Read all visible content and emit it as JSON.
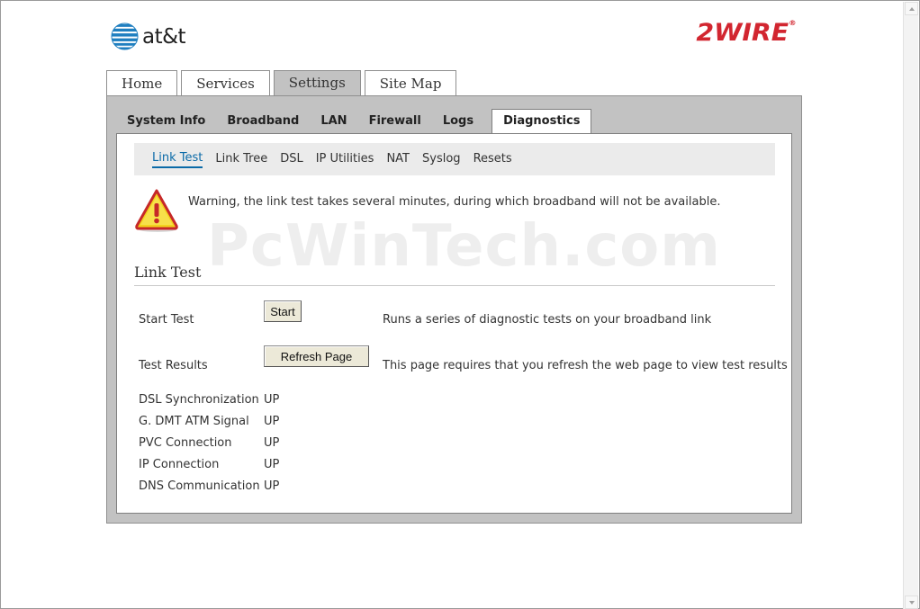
{
  "brand": {
    "att_label": "at&t",
    "wire_label": "2WIRE",
    "wire_mark": "®",
    "colors": {
      "wire_red": "#d22630",
      "att_blue": "#1f7fc0",
      "link_blue": "#0a6aa8",
      "panel_gray": "#c2c2c2"
    }
  },
  "main_tabs": [
    {
      "label": "Home"
    },
    {
      "label": "Services"
    },
    {
      "label": "Settings",
      "active": true
    },
    {
      "label": "Site Map"
    }
  ],
  "sub_tabs": [
    {
      "label": "System Info"
    },
    {
      "label": "Broadband"
    },
    {
      "label": "LAN"
    },
    {
      "label": "Firewall"
    },
    {
      "label": "Logs"
    },
    {
      "label": "Diagnostics",
      "active": true
    }
  ],
  "sub_nav": [
    {
      "label": "Link Test",
      "active": true
    },
    {
      "label": "Link Tree"
    },
    {
      "label": "DSL"
    },
    {
      "label": "IP Utilities"
    },
    {
      "label": "NAT"
    },
    {
      "label": "Syslog"
    },
    {
      "label": "Resets"
    }
  ],
  "warning": {
    "icon": "warning-icon",
    "text": "Warning, the link test takes several minutes, during which broadband will not be available."
  },
  "watermark": "PcWinTech.com",
  "link_test": {
    "title": "Link Test",
    "start": {
      "label": "Start Test",
      "button": "Start",
      "description": "Runs a series of diagnostic tests on your broadband link"
    },
    "results": {
      "label": "Test Results",
      "button": "Refresh Page",
      "description": "This page requires that you refresh the web page to view test results"
    },
    "statuses": [
      {
        "name": "DSL Synchronization",
        "value": "UP"
      },
      {
        "name": "G. DMT ATM Signal",
        "value": "UP"
      },
      {
        "name": "PVC Connection",
        "value": "UP"
      },
      {
        "name": "IP Connection",
        "value": "UP"
      },
      {
        "name": "DNS Communication",
        "value": "UP"
      }
    ]
  }
}
